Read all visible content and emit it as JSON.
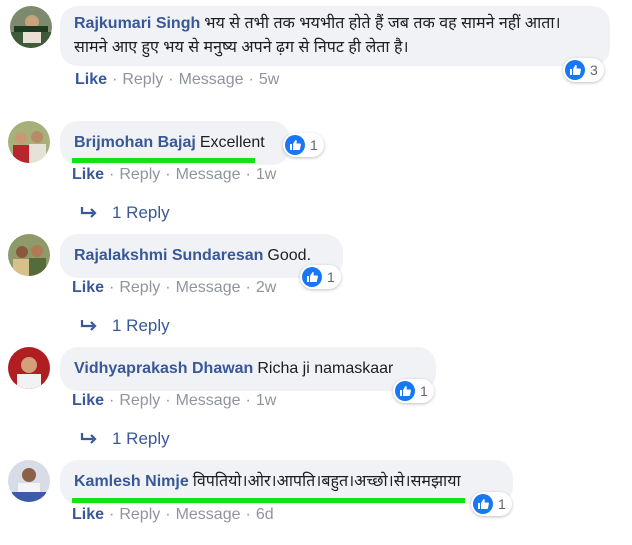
{
  "comments": [
    {
      "author": "Rajkumari Singh",
      "text": "भय से तभी तक भयभीत होते हैं जब तक वह सामने नहीं आता। सामने आए हुए भय से मनुष्य अपने ढ़ग से निपट ही लेता है।",
      "actions": {
        "like": "Like",
        "reply": "Reply",
        "message": "Message",
        "time": "5w"
      },
      "reactions": "3"
    },
    {
      "author": "Brijmohan Bajaj",
      "text": "Excellent",
      "actions": {
        "like": "Like",
        "reply": "Reply",
        "message": "Message",
        "time": "1w"
      },
      "reactions": "1",
      "replies": "1 Reply"
    },
    {
      "author": "Rajalakshmi Sundaresan",
      "text": "Good.",
      "actions": {
        "like": "Like",
        "reply": "Reply",
        "message": "Message",
        "time": "2w"
      },
      "reactions": "1",
      "replies": "1 Reply"
    },
    {
      "author": "Vidhyaprakash Dhawan",
      "text": "Richa ji namaskaar",
      "actions": {
        "like": "Like",
        "reply": "Reply",
        "message": "Message",
        "time": "1w"
      },
      "reactions": "1",
      "replies": "1 Reply"
    },
    {
      "author": "Kamlesh Nimje",
      "text": "विपतियो।ओर।आपति।बहुत।अच्छो।से।समझाया",
      "actions": {
        "like": "Like",
        "reply": "Reply",
        "message": "Message",
        "time": "6d"
      },
      "reactions": "1"
    }
  ],
  "colors": {
    "author": "#385898",
    "bubble": "#f0f2f5",
    "like_badge": "#1877f2",
    "highlight": "#14e214",
    "meta": "#90949c"
  },
  "icons": [
    "like-thumb-icon",
    "reply-arrow-icon"
  ]
}
